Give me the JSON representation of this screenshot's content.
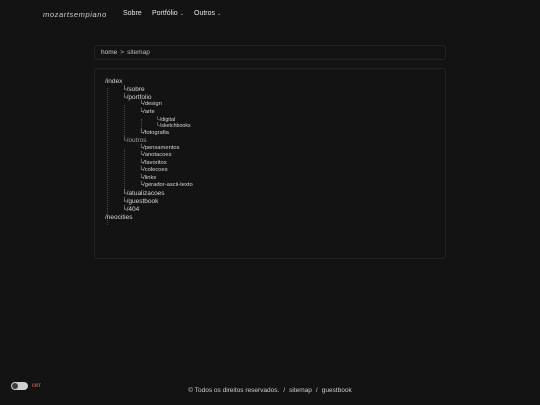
{
  "nav": {
    "logo": "mozartsempiano",
    "items": [
      {
        "label": "Sobre",
        "caret": ""
      },
      {
        "label": "Portfólio",
        "caret": "⌄"
      },
      {
        "label": "Outros",
        "caret": "⌄"
      }
    ]
  },
  "breadcrumb": {
    "home": "home",
    "separator": ">",
    "current": "sitemap"
  },
  "sitemap": {
    "index": "/index",
    "sobre": "└/sobre",
    "portfolio": "└/portfolio",
    "design": "└/design",
    "arte": "└/arte",
    "digital": "└/digital",
    "sketchbooks": "└/sketchbooks",
    "fotografia": "└/fotografia",
    "outros": "└/outros",
    "pensamentos": "└/pensamentos",
    "anotacoes": "└/anotacoes",
    "favoritos": "└/favoritos",
    "colecoes": "└/colecoes",
    "links": "└/links",
    "gerador": "└/gerador-ascii-texto",
    "atualizacoes": "└/atualizacoes",
    "guestbook": "└/guestbook",
    "notfound": "└/404",
    "neocities": "/neocities"
  },
  "footer": {
    "crt_label": "CRT",
    "copyright": "© Todos os direitos reservados.",
    "sep": "/",
    "sitemap": "sitemap",
    "guestbook": "guestbook"
  },
  "colors": {
    "background": "#131313",
    "text": "#d8d8d8",
    "crt_accent": "#d24a4a"
  }
}
